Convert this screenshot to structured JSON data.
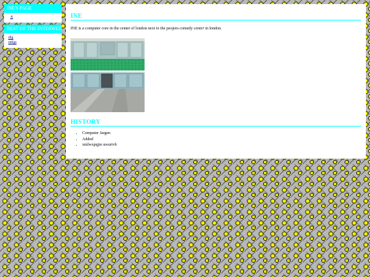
{
  "nav": {
    "boxes": [
      {
        "title": "INE'S PAGE",
        "links": [
          "A"
        ]
      },
      {
        "title": "BEST OF THE INTERWEBZ",
        "links": [
          "dfg",
          "ddfgs"
        ]
      }
    ]
  },
  "main": {
    "title": "INE",
    "intro_before": "INE is a computer core in the center of london next to the peojees comedy ",
    "intro_em": "center",
    "intro_after": " in london.",
    "photo_alt": "kitchen with green tiled wall",
    "history_title": "HISTORY",
    "history_items": [
      "Computer Jargen",
      "Added",
      "xmlwxpqjm uwurivb"
    ]
  },
  "colors": {
    "accent": "#00ffff",
    "link": "#00008b",
    "panel": "#ffffff"
  }
}
